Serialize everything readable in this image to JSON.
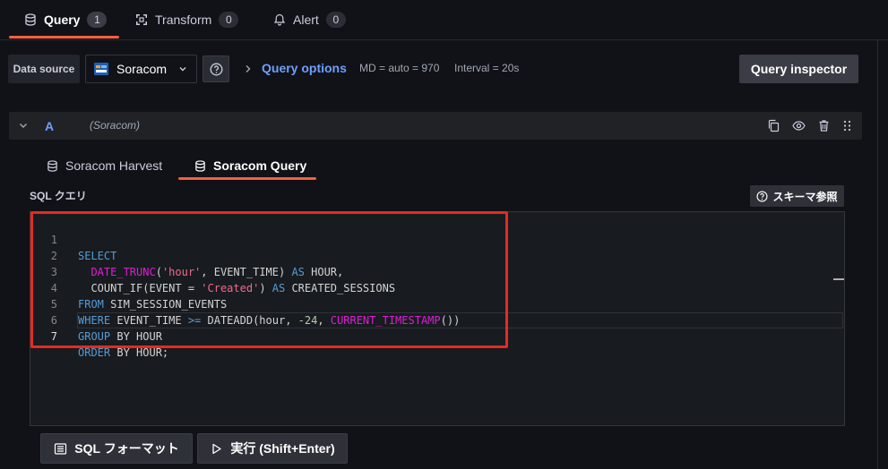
{
  "tabs": [
    {
      "label": "Query",
      "count": "1",
      "icon": "database-icon",
      "active": true
    },
    {
      "label": "Transform",
      "count": "0",
      "icon": "transform-icon",
      "active": false
    },
    {
      "label": "Alert",
      "count": "0",
      "icon": "bell-icon",
      "active": false
    }
  ],
  "datasource": {
    "label": "Data source",
    "selected": "Soracom",
    "icon": "soracom-logo-icon"
  },
  "query_options": {
    "label": "Query options",
    "md": "MD = auto = 970",
    "interval": "Interval = 20s"
  },
  "query_inspector_label": "Query inspector",
  "query_row": {
    "ref_id": "A",
    "datasource_name": "(Soracom)"
  },
  "subtabs": [
    {
      "label": "Soracom Harvest",
      "active": false
    },
    {
      "label": "Soracom Query",
      "active": true
    }
  ],
  "sql_label": "SQL クエリ",
  "schema_button_label": "スキーマ参照",
  "editor": {
    "lines": [
      {
        "n": "1",
        "code": "SELECT"
      },
      {
        "n": "2",
        "code": "  DATE_TRUNC('hour', EVENT_TIME) AS HOUR,"
      },
      {
        "n": "3",
        "code": "  COUNT_IF(EVENT = 'Created') AS CREATED_SESSIONS"
      },
      {
        "n": "4",
        "code": "FROM SIM_SESSION_EVENTS"
      },
      {
        "n": "5",
        "code": "WHERE EVENT_TIME >= DATEADD(hour, -24, CURRENT_TIMESTAMP())"
      },
      {
        "n": "6",
        "code": "GROUP BY HOUR"
      },
      {
        "n": "7",
        "code": "ORDER BY HOUR;"
      }
    ]
  },
  "buttons": {
    "format": "SQL フォーマット",
    "run": "実行 (Shift+Enter)"
  },
  "colors": {
    "accent": "#f55f3e",
    "link": "#6e9fff",
    "highlight": "#e62a1f",
    "keyword": "#569cd6",
    "function": "#e01cd8",
    "string": "#f26a8d"
  }
}
